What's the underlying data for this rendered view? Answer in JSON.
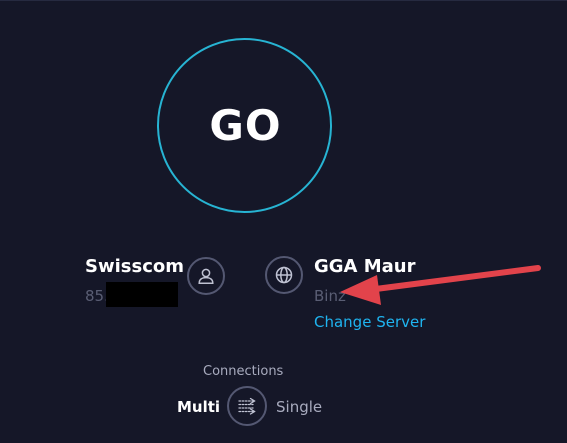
{
  "go_button": {
    "label": "GO"
  },
  "isp": {
    "name": "Swisscom",
    "ip_visible": "85."
  },
  "server": {
    "name": "GGA Maur",
    "location": "Binz",
    "change_link": "Change Server"
  },
  "connections": {
    "label": "Connections",
    "multi": "Multi",
    "single": "Single",
    "selected": "Multi"
  },
  "icons": {
    "isp": "user-icon",
    "server": "globe-icon",
    "toggle": "connections-toggle-icon"
  },
  "colors": {
    "background": "#151728",
    "go_ring": "#27b4d3",
    "link": "#1fb4f0",
    "icon_ring": "#545872",
    "muted_text": "#5a5e74",
    "annotation_arrow": "#e2434b"
  }
}
